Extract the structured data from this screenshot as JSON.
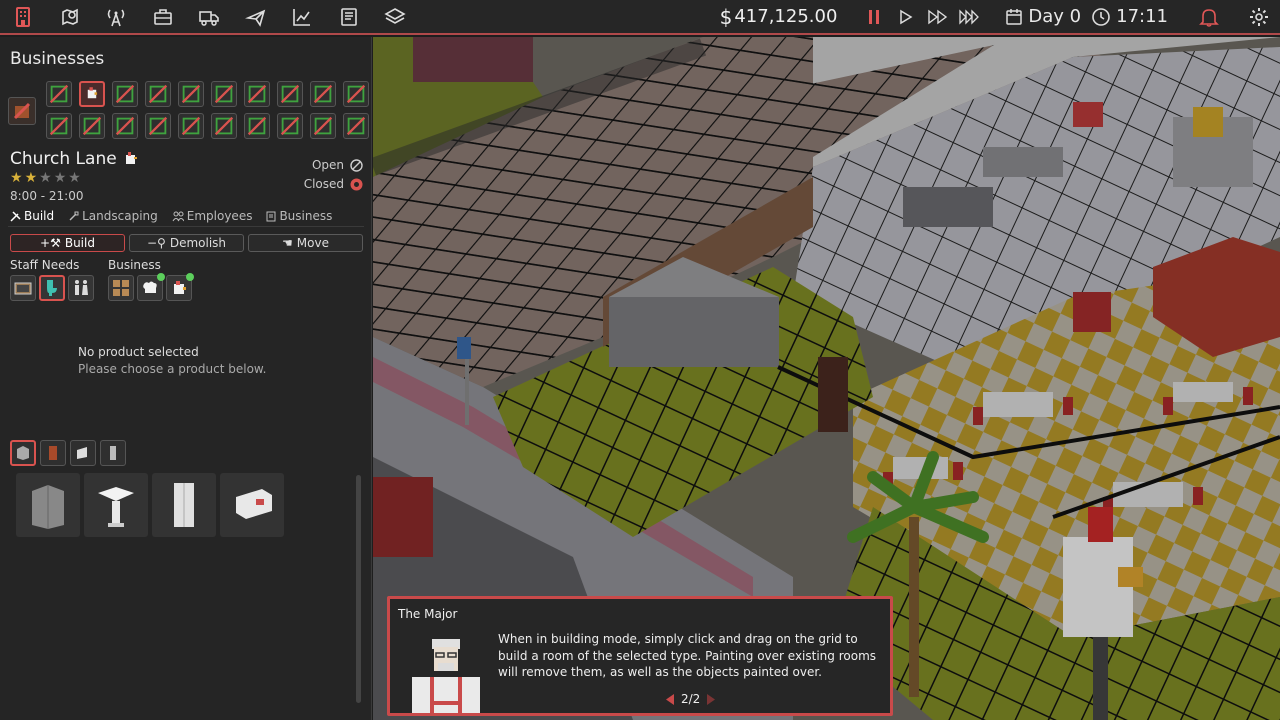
{
  "topbar": {
    "nav_icons": [
      "building-icon",
      "map-pin-icon",
      "broadcast-icon",
      "briefcase-icon",
      "truck-icon",
      "plane-icon",
      "chart-icon",
      "book-icon",
      "layers-icon"
    ],
    "money_symbol": "$",
    "money": "417,125.00",
    "day": "Day 0",
    "time": "17:11"
  },
  "panel": {
    "title": "Businesses",
    "location_name": "Church Lane",
    "rating": 2,
    "rating_max": 5,
    "hours": "8:00 - 21:00",
    "open_label": "Open",
    "closed_label": "Closed",
    "tabs": [
      "Build",
      "Landscaping",
      "Employees",
      "Business"
    ],
    "tools": {
      "build": "Build",
      "demolish": "Demolish",
      "move": "Move"
    },
    "staff_needs_label": "Staff Needs",
    "business_label": "Business",
    "no_product": "No product selected",
    "no_product_hint": "Please choose a product below."
  },
  "dialog": {
    "speaker": "The Major",
    "text": "When in building mode, simply click and drag on the grid to build a room of the selected type.  Painting over existing rooms will remove them, as well as the objects painted over.",
    "page": "2/2"
  },
  "colors": {
    "accent": "#c94a4a",
    "panel_bg": "#252525",
    "star": "#d9b23a",
    "active_dot": "#5ccf5c"
  }
}
